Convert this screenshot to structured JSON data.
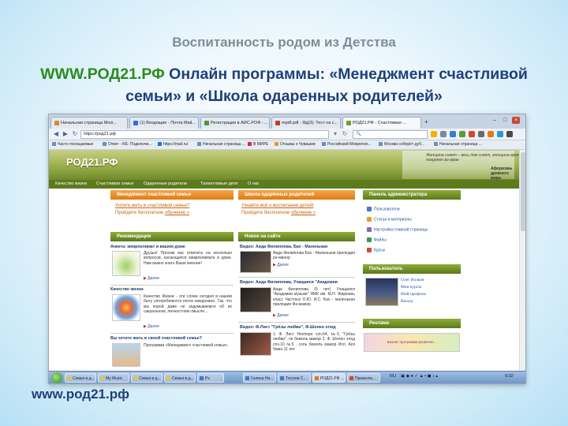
{
  "slide": {
    "subtitle": "Воспитанность родом из Детства",
    "title_url": "WWW.РОД21.РФ",
    "title_line1_rest": " Онлайн программы: «Менеджмент счастливой",
    "title_line2": "семьи» и «Школа одаренных родителей»",
    "footer_url": "www.род21.рф"
  },
  "browser": {
    "tabs": [
      {
        "label": "Начальная страница Mozi..."
      },
      {
        "label": "(1) Входящие - Почта Mail..."
      },
      {
        "label": "Регистрация в АИС.РОФ - ..."
      },
      {
        "label": "mpdf.pdf - Яд(3): Тест на с..."
      },
      {
        "label": "РОД21.РФ - Счастливая ...",
        "active": true
      }
    ],
    "address": "https://род21.рф",
    "bookmarks": [
      "Часто посещаемые",
      "Ответ - RE: Подключи...",
      "https://mail.ru/",
      "Начальная страница ...",
      "В МИРЕ",
      "Отзывы о Чувашии",
      "Российский Межрегио...",
      "Москва соберёт дуб...",
      "Начальная страница ..."
    ]
  },
  "site": {
    "logo": "РОД21.РФ",
    "quote": "Женщина сияет – весь дом сияет, женщина мрачна – весь дом погружен во мрак",
    "quote_source": "Афоризмы древнего мира",
    "nav": [
      "Качество жизни",
      "Счастливая семья",
      "Одаренные родители",
      "Талантливые дети",
      "О нас"
    ],
    "happy_family": {
      "header": "Менеджмент счастливой семьи",
      "link1": "Хотите жить в счастливой семье?",
      "link2_prefix": "Пройдите бесплатное ",
      "link2_word": "обучение »"
    },
    "gifted_parents": {
      "header": "Школа одарённых родителей",
      "link1": "Узнайте всё о воспитании детей!",
      "link2_prefix": "Пройдите бесплатное ",
      "link2_word": "обучение »"
    },
    "recommendations": {
      "header": "Рекомендации",
      "items": [
        {
          "title": "Анкета: микроклимат в вашем доме",
          "body": "Друзья! Просим вас ответить на несколько вопросов, касающихся микроклимата в доме. Нам важно знать Ваше мнение!",
          "more": "Далее"
        },
        {
          "title": "Качество жизни",
          "body": "Качество Жизни - эти слова сегодня в нашем быту употребляются почти ежедневно. Так, что мы порой даже не задумываемся об их сакральном, личностном смысле...",
          "more": "Далее"
        },
        {
          "title": "Вы хотите жить в своей счастливой семье?",
          "body": "Программа «Менеджмент счастливой семьи».",
          "more": ""
        }
      ]
    },
    "news": {
      "header": "Новое на сайте",
      "items": [
        {
          "title": "Видео: Аида Филиппова. Бах - Маленькая",
          "body": "Аида Филиппова Бах - Маленькая прелюдия ре-минор",
          "more": "Далее"
        },
        {
          "title": "Видео: Аида Филиппова. Учащаяся \"Академии",
          "body": "Аида Филиппова (5 лет) Учащаяся \"Академии музыки\" ЯМК им. М.Н. Жиркова, класс Частных О.Ю. И.С. Бах - маленькая прелюдия Фа-мажор",
          "more": "Далее"
        },
        {
          "title": "Видео: Ф.Лист \"Грёзы любви\", Ф.Шопен этюд",
          "body": "1. Ф. Лист Ноктюрн соч.64, №3, \"Грёзы любви\", ля бемоль мажор 2. Ф. Шопен этюд соч.10 №5 , соль бемоль мажор Исп. Ася Чжан 11 лет",
          "more": ""
        }
      ]
    },
    "admin": {
      "header": "Панель администратора",
      "items": [
        "Пользователи",
        "Статьи и материалы",
        "Настройка главной страницы",
        "Файлы",
        "Курсы"
      ]
    },
    "users": {
      "header": "Пользователь",
      "name": "Олег Волков",
      "links": [
        "Мои курсы",
        "Мой профиль",
        "Выход"
      ]
    },
    "ads": {
      "header": "Реклама",
      "banner_text": "Бизнес программа развития..."
    }
  },
  "taskbar": {
    "tasks": [
      "Семья в д...",
      "My Music",
      "Семья в д...",
      "Семья в д...",
      "Рз",
      "Галина Ни...",
      "Тогузов С...",
      "РОД21.РФ ...",
      "Презента..."
    ],
    "lang": "RU",
    "clock": "9:32"
  },
  "colors": {
    "title_blue": "#1f3f7a",
    "url_green": "#2a8c1e",
    "site_orange": "#e07b12",
    "site_green": "#5b7a18",
    "link_blue": "#1f4f9c"
  }
}
